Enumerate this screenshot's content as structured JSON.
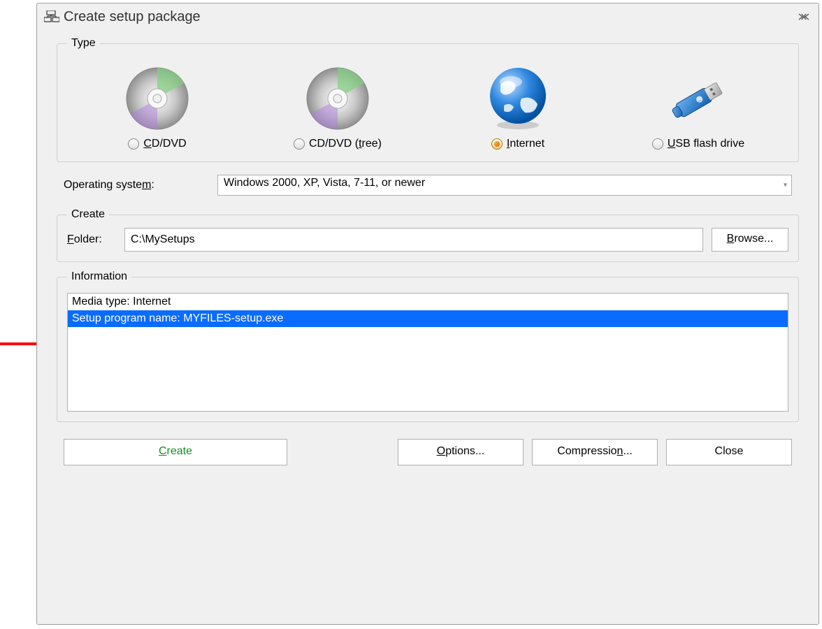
{
  "window": {
    "title": "Create setup package"
  },
  "type": {
    "legend": "Type",
    "options": [
      {
        "label_pre": "",
        "label_u": "C",
        "label_post": "D/DVD",
        "selected": false,
        "icon": "cd"
      },
      {
        "label_pre": "CD/DVD (",
        "label_u": "t",
        "label_post": "ree)",
        "selected": false,
        "icon": "cd"
      },
      {
        "label_pre": "",
        "label_u": "I",
        "label_post": "nternet",
        "selected": true,
        "icon": "globe"
      },
      {
        "label_pre": "",
        "label_u": "U",
        "label_post": "SB flash drive",
        "selected": false,
        "icon": "usb"
      }
    ]
  },
  "os": {
    "label_pre": "Operating syste",
    "label_u": "m",
    "label_post": ":",
    "value": "Windows 2000, XP, Vista, 7-11, or newer"
  },
  "create": {
    "legend": "Create",
    "folder_label_u": "F",
    "folder_label_post": "older:",
    "folder_value": "C:\\MySetups",
    "browse_u": "B",
    "browse_post": "rowse..."
  },
  "information": {
    "legend": "Information",
    "lines": [
      {
        "text": "Media type: Internet",
        "selected": false
      },
      {
        "text": "Setup program name: MYFILES-setup.exe",
        "selected": true
      }
    ]
  },
  "buttons": {
    "create_u": "C",
    "create_post": "reate",
    "options_u": "O",
    "options_post": "ptions...",
    "compression_pre": "Compressio",
    "compression_u": "n",
    "compression_post": "...",
    "close": "Close"
  }
}
